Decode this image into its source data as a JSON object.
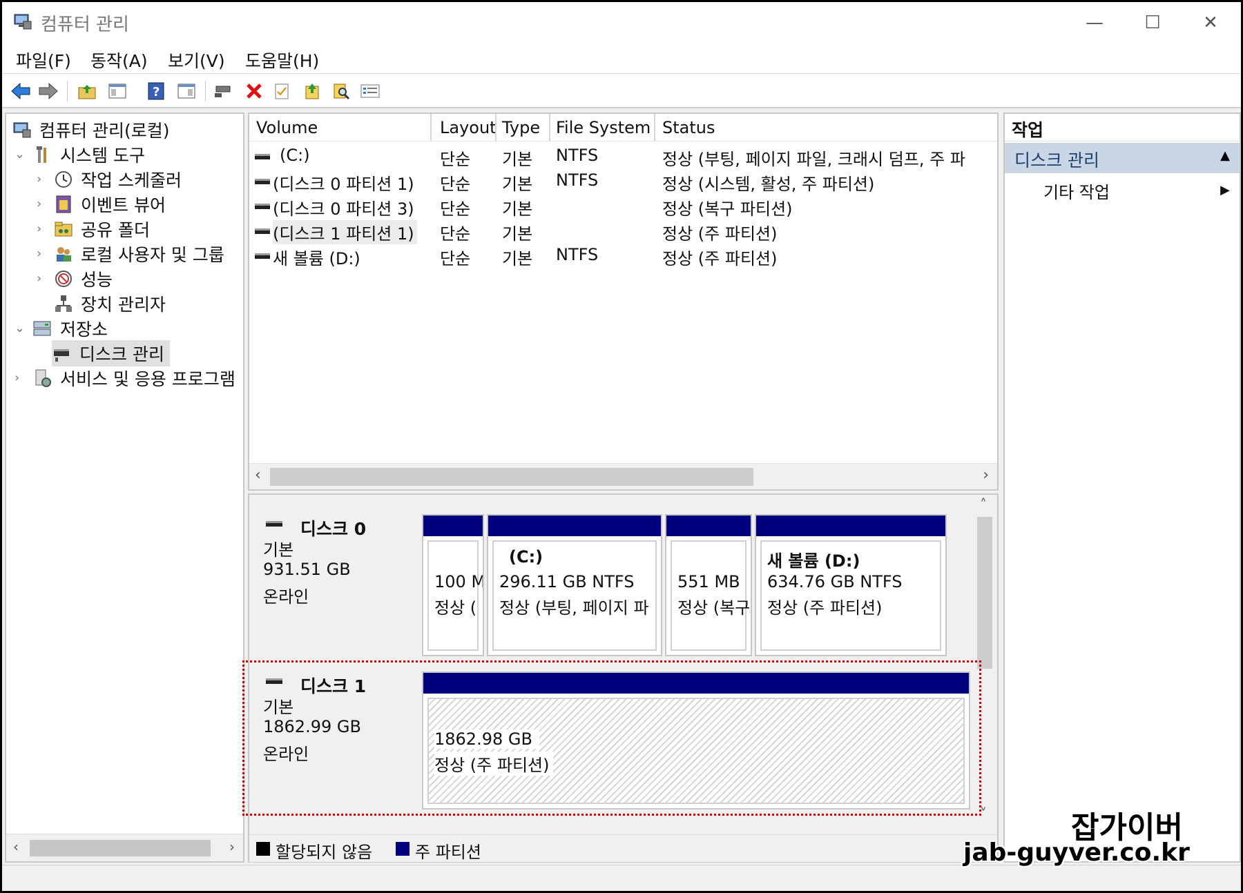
{
  "window": {
    "title": "컴퓨터 관리",
    "minimize": "—",
    "maximize": "☐",
    "close": "✕"
  },
  "menu": [
    {
      "label": "파일(F)"
    },
    {
      "label": "동작(A)"
    },
    {
      "label": "보기(V)"
    },
    {
      "label": "도움말(H)"
    }
  ],
  "toolbar": {
    "icons": [
      "back-arrow-icon",
      "forward-arrow-icon",
      "up-folder-icon",
      "show-hide-console-tree-icon",
      "help-icon",
      "show-hide-action-pane-icon",
      "connect-icon",
      "delete-icon",
      "properties-icon",
      "export-icon",
      "find-icon",
      "options-icon"
    ]
  },
  "tree": {
    "root": "컴퓨터 관리(로컬)",
    "system_tools": "시스템 도구",
    "task_scheduler": "작업 스케줄러",
    "event_viewer": "이벤트 뷰어",
    "shared_folders": "공유 폴더",
    "local_users": "로컬 사용자 및 그룹",
    "performance": "성능",
    "device_manager": "장치 관리자",
    "storage": "저장소",
    "disk_management": "디스크 관리",
    "services": "서비스 및 응용 프로그램"
  },
  "volume_list": {
    "columns": [
      "Volume",
      "Layout",
      "Type",
      "File System",
      "Status"
    ],
    "rows": [
      {
        "volume": "(C:)",
        "layout": "단순",
        "type": "기본",
        "fs": "NTFS",
        "status": "정상 (부팅, 페이지 파일, 크래시 덤프, 주 파"
      },
      {
        "volume": "(디스크 0 파티션 1)",
        "layout": "단순",
        "type": "기본",
        "fs": "NTFS",
        "status": "정상 (시스템, 활성, 주 파티션)"
      },
      {
        "volume": "(디스크 0 파티션 3)",
        "layout": "단순",
        "type": "기본",
        "fs": "",
        "status": "정상 (복구 파티션)"
      },
      {
        "volume": "(디스크 1 파티션 1)",
        "layout": "단순",
        "type": "기본",
        "fs": "",
        "status": "정상 (주 파티션)"
      },
      {
        "volume": "새 볼륨 (D:)",
        "layout": "단순",
        "type": "기본",
        "fs": "NTFS",
        "status": "정상 (주 파티션)"
      }
    ]
  },
  "disks": [
    {
      "name": "디스크 0",
      "kind": "기본",
      "size": "931.51 GB",
      "state": "온라인",
      "partitions": [
        {
          "title": "",
          "size": "100 M",
          "status": "정상 ("
        },
        {
          "title": "(C:)",
          "size": "296.11 GB NTFS",
          "status": "정상 (부팅, 페이지 파"
        },
        {
          "title": "",
          "size": "551 MB",
          "status": "정상 (복구"
        },
        {
          "title": "새 볼륨  (D:)",
          "size": "634.76 GB NTFS",
          "status": "정상 (주 파티션)"
        }
      ]
    },
    {
      "name": "디스크 1",
      "kind": "기본",
      "size": "1862.99 GB",
      "state": "온라인",
      "partitions": [
        {
          "title": "",
          "size": "1862.98 GB",
          "status": "정상 (주 파티션)"
        }
      ]
    }
  ],
  "legend": {
    "unallocated": "할당되지 않음",
    "primary": "주 파티션",
    "unallocated_color": "#000000",
    "primary_color": "#00007f"
  },
  "actions": {
    "header": "작업",
    "section": "디스크 관리",
    "more": "기타 작업"
  },
  "watermark": {
    "line1": "잡가이버",
    "line2": "jab-guyver.co.kr"
  },
  "colors": {
    "partition_bar": "#00007f",
    "highlight": "#cc0000",
    "action_section_bg": "#c8d6e5"
  }
}
